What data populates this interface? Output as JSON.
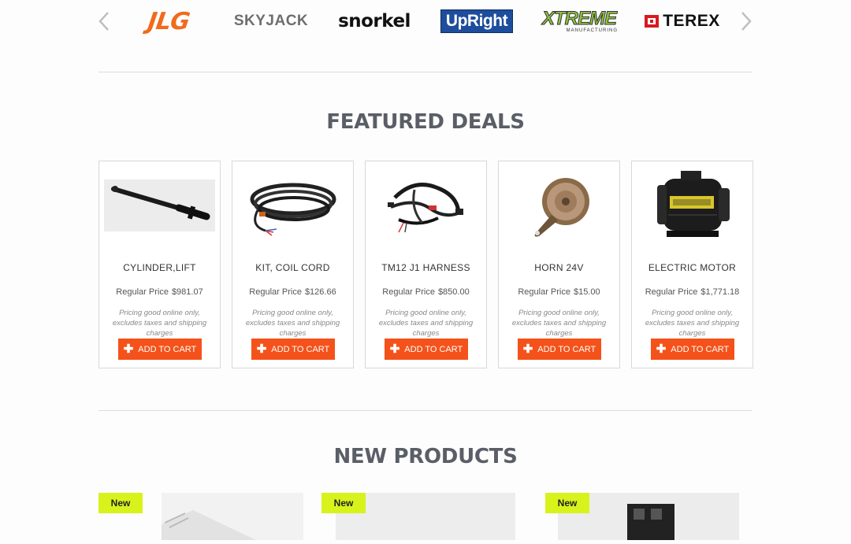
{
  "carousel": {
    "prev_icon": "chevron-left-icon",
    "next_icon": "chevron-right-icon",
    "brands": [
      {
        "name": "JLG",
        "color": "#f26a1b"
      },
      {
        "name": "SKYJACK",
        "color": "#6e6e6e"
      },
      {
        "name": "snorkel",
        "color": "#111111"
      },
      {
        "name": "UpRight",
        "color": "#1d4d9c"
      },
      {
        "name": "XTREME",
        "sub": "MANUFACTURING",
        "color": "#8fc63e"
      },
      {
        "name": "TEREX",
        "color": "#d71920"
      }
    ]
  },
  "featured": {
    "title": "FEATURED DEALS",
    "price_label": "Regular Price",
    "note": "Pricing good online only, excludes taxes and shipping charges",
    "button_label": "ADD TO CART",
    "button_color": "#f4521a",
    "products": [
      {
        "name": "CYLINDER,LIFT",
        "price": "$981.07",
        "image": "hydraulic-cylinder"
      },
      {
        "name": "KIT, COIL CORD",
        "price": "$126.66",
        "image": "coil-cord"
      },
      {
        "name": "TM12 J1 HARNESS",
        "price": "$850.00",
        "image": "wire-harness"
      },
      {
        "name": "HORN 24V",
        "price": "$15.00",
        "image": "horn"
      },
      {
        "name": "ELECTRIC MOTOR",
        "price": "$1,771.18",
        "image": "electric-motor"
      }
    ]
  },
  "new_products": {
    "title": "NEW PRODUCTS",
    "badge": "New",
    "badge_color": "#d8f31b"
  }
}
